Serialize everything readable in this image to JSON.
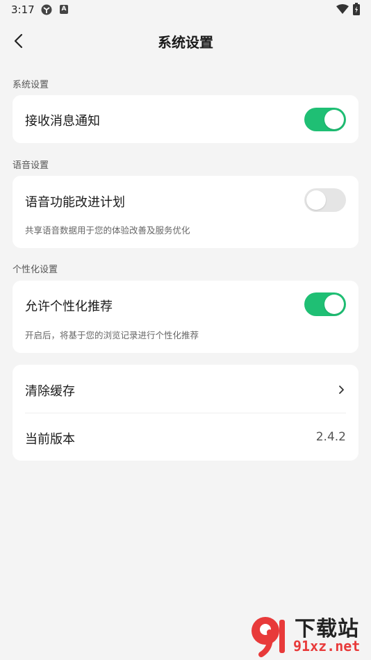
{
  "status_bar": {
    "time": "3:17",
    "colors": {
      "text": "#222222"
    }
  },
  "header": {
    "title": "系统设置"
  },
  "sections": {
    "system": {
      "label": "系统设置",
      "items": [
        {
          "label": "接收消息通知",
          "toggle_on": true
        }
      ]
    },
    "voice": {
      "label": "语音设置",
      "items": [
        {
          "label": "语音功能改进计划",
          "toggle_on": false,
          "description": "共享语音数据用于您的体验改善及服务优化"
        }
      ]
    },
    "personalization": {
      "label": "个性化设置",
      "items": [
        {
          "label": "允许个性化推荐",
          "toggle_on": true,
          "description": "开启后，将基于您的浏览记录进行个性化推荐"
        }
      ]
    },
    "other": {
      "clear_cache": {
        "label": "清除缓存"
      },
      "version": {
        "label": "当前版本",
        "value": "2.4.2"
      }
    }
  },
  "watermark": {
    "text_top": "下载站",
    "text_bottom": "91xz.net"
  },
  "colors": {
    "accent": "#1fbf74",
    "background": "#f4f4f4",
    "card": "#ffffff",
    "toggle_off": "#e5e5e5"
  }
}
